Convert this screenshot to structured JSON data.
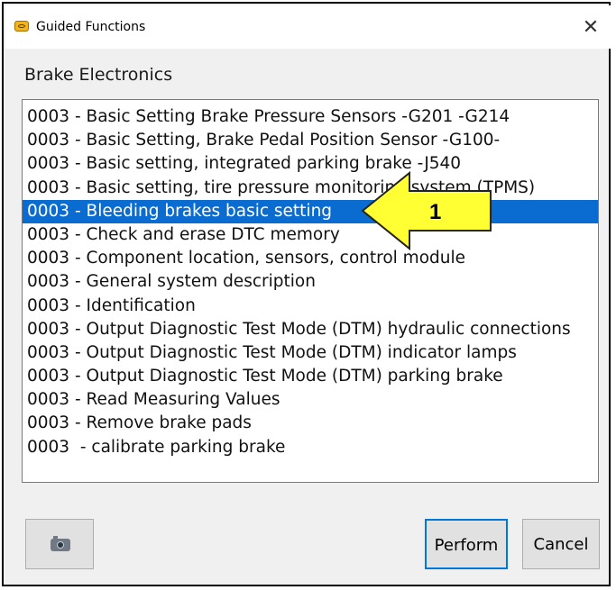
{
  "window": {
    "title": "Guided Functions",
    "close_glyph": "✕"
  },
  "section": {
    "label": "Brake Electronics"
  },
  "functions": {
    "items": [
      "0003 - Basic Setting Brake Pressure Sensors -G201 -G214",
      "0003 - Basic Setting, Brake Pedal Position Sensor -G100-",
      "0003 - Basic setting, integrated parking brake -J540",
      "0003 - Basic setting, tire pressure monitoring system (TPMS)",
      "0003 - Bleeding brakes basic setting",
      "0003 - Check and erase DTC memory",
      "0003 - Component location, sensors, control module",
      "0003 - General system description",
      "0003 - Identification",
      "0003 - Output Diagnostic Test Mode (DTM) hydraulic connections",
      "0003 - Output Diagnostic Test Mode (DTM) indicator lamps",
      "0003 - Output Diagnostic Test Mode (DTM) parking brake",
      "0003 - Read Measuring Values",
      "0003 - Remove brake pads",
      "0003  - calibrate parking brake"
    ],
    "selected_index": 4
  },
  "callout": {
    "label": "1",
    "color": "#ffff33"
  },
  "buttons": {
    "camera_icon": "camera-icon",
    "perform": "Perform",
    "cancel": "Cancel"
  },
  "colors": {
    "selection": "#0a6bd0",
    "dialog_bg": "#f0f0f0"
  }
}
